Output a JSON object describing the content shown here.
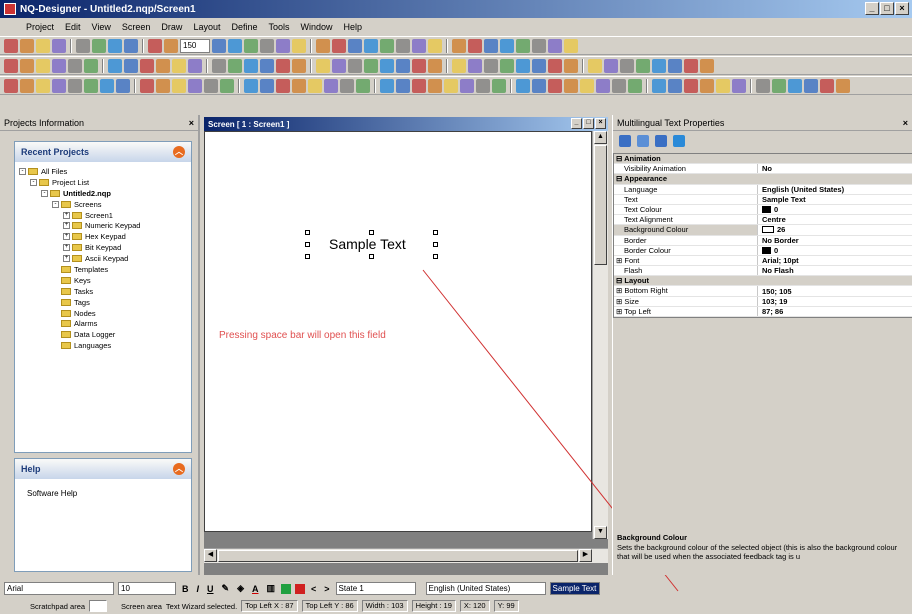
{
  "window": {
    "title": "NQ-Designer - Untitled2.nqp/Screen1"
  },
  "menu": [
    "Project",
    "Edit",
    "View",
    "Screen",
    "Draw",
    "Layout",
    "Define",
    "Tools",
    "Window",
    "Help"
  ],
  "toolbar": {
    "zoom": "150"
  },
  "projects_panel": {
    "title": "Projects Information",
    "recent_title": "Recent Projects",
    "tree": [
      {
        "label": "All Files",
        "indent": 0,
        "exp": "-"
      },
      {
        "label": "Project List",
        "indent": 1,
        "exp": "-"
      },
      {
        "label": "Untitled2.nqp",
        "indent": 2,
        "exp": "-",
        "bold": true
      },
      {
        "label": "Screens",
        "indent": 3,
        "exp": "-"
      },
      {
        "label": "Screen1",
        "indent": 4,
        "exp": "+"
      },
      {
        "label": "Numeric Keypad",
        "indent": 4,
        "exp": "+"
      },
      {
        "label": "Hex Keypad",
        "indent": 4,
        "exp": "+"
      },
      {
        "label": "Bit Keypad",
        "indent": 4,
        "exp": "+"
      },
      {
        "label": "Ascii Keypad",
        "indent": 4,
        "exp": "+"
      },
      {
        "label": "Templates",
        "indent": 3,
        "exp": ""
      },
      {
        "label": "Keys",
        "indent": 3,
        "exp": ""
      },
      {
        "label": "Tasks",
        "indent": 3,
        "exp": ""
      },
      {
        "label": "Tags",
        "indent": 3,
        "exp": ""
      },
      {
        "label": "Nodes",
        "indent": 3,
        "exp": ""
      },
      {
        "label": "Alarms",
        "indent": 3,
        "exp": ""
      },
      {
        "label": "Data Logger",
        "indent": 3,
        "exp": ""
      },
      {
        "label": "Languages",
        "indent": 3,
        "exp": ""
      }
    ],
    "help_title": "Help",
    "help_item": "Software Help"
  },
  "screen_window": {
    "title": "Screen [ 1 : Screen1 ]",
    "sample_text": "Sample Text",
    "hint": "Pressing space bar will open this field"
  },
  "properties": {
    "title": "Multilingual Text Properties",
    "rows": [
      {
        "type": "cat",
        "name": "Animation"
      },
      {
        "type": "prop",
        "name": "Visibility Animation",
        "value": "No"
      },
      {
        "type": "cat",
        "name": "Appearance"
      },
      {
        "type": "prop",
        "name": "Language",
        "value": "English (United States)"
      },
      {
        "type": "prop",
        "name": "Text",
        "value": "Sample Text"
      },
      {
        "type": "prop",
        "name": "Text Colour",
        "value": "0",
        "swatch": "black"
      },
      {
        "type": "prop",
        "name": "Text Alignment",
        "value": "Centre"
      },
      {
        "type": "prop",
        "name": "Background Colour",
        "value": "26",
        "swatch": "white",
        "selected": true
      },
      {
        "type": "prop",
        "name": "Border",
        "value": "No Border"
      },
      {
        "type": "prop",
        "name": "Border Colour",
        "value": "0",
        "swatch": "black"
      },
      {
        "type": "prop",
        "name": "Font",
        "value": "Arial; 10pt",
        "expander": "+"
      },
      {
        "type": "prop",
        "name": "Flash",
        "value": "No Flash"
      },
      {
        "type": "cat",
        "name": "Layout"
      },
      {
        "type": "prop",
        "name": "Bottom Right",
        "value": "150; 105",
        "expander": "+"
      },
      {
        "type": "prop",
        "name": "Size",
        "value": "103; 19",
        "expander": "+"
      },
      {
        "type": "prop",
        "name": "Top Left",
        "value": "87; 86",
        "expander": "+"
      }
    ],
    "desc_title": "Background Colour",
    "desc_text": "Sets the background colour of the selected object (this is also the background colour that will be used when the associated feedback tag is u"
  },
  "format_bar": {
    "font": "Arial",
    "size": "10",
    "state": "State 1",
    "language": "English (United States)",
    "text_field": "Sample Text"
  },
  "status": {
    "scratchpad": "Scratchpad area",
    "screen_area": "Screen area",
    "message": "Text Wizard selected.",
    "top_left_x": "Top Left X : 87",
    "top_left_y": "Top Left Y : 86",
    "width": "Width : 103",
    "height": "Height : 19",
    "x": "X: 120",
    "y": "Y: 99"
  },
  "colors": {
    "accent": "#0a246a",
    "hint": "#e05050",
    "card_header": "#c7d5ea"
  }
}
